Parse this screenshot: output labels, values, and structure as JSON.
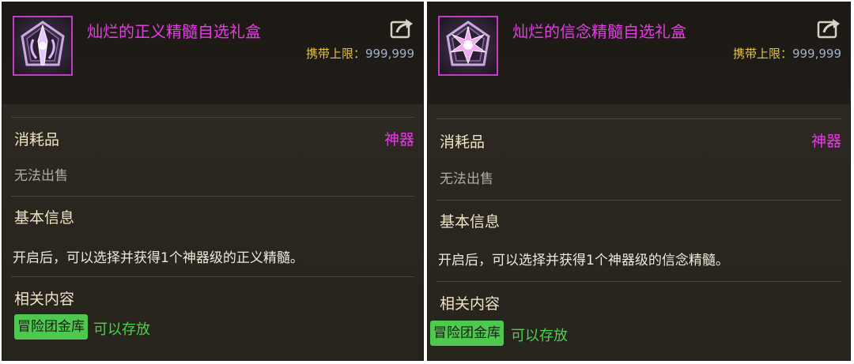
{
  "panels": [
    {
      "item_name": "灿烂的正义精髓自选礼盒",
      "carry_label": "携带上限：",
      "carry_value": "999,999",
      "category": "消耗品",
      "grade": "神器",
      "trade": "无法出售",
      "basic_title": "基本信息",
      "description": "开启后，可以选择并获得1个神器级的正义精髓。",
      "related_title": "相关内容",
      "storage_tag": "冒险团金库",
      "storage_note": "可以存放"
    },
    {
      "item_name": "灿烂的信念精髓自选礼盒",
      "carry_label": "携带上限：",
      "carry_value": "999,999",
      "category": "消耗品",
      "grade": "神器",
      "trade": "无法出售",
      "basic_title": "基本信息",
      "description": "开启后，可以选择并获得1个神器级的信念精髓。",
      "related_title": "相关内容",
      "storage_tag": "冒险团金库",
      "storage_note": "可以存放"
    }
  ],
  "icons": [
    "justice-essence-icon",
    "faith-essence-icon",
    "share-icon"
  ],
  "colors": {
    "item_name": "#e23ee2",
    "grade": "#e23ee2",
    "carry_label": "#e8c43a",
    "carry_value": "#9fb1c8",
    "tag_bg": "#4ec84e",
    "tag_note": "#46d646"
  }
}
